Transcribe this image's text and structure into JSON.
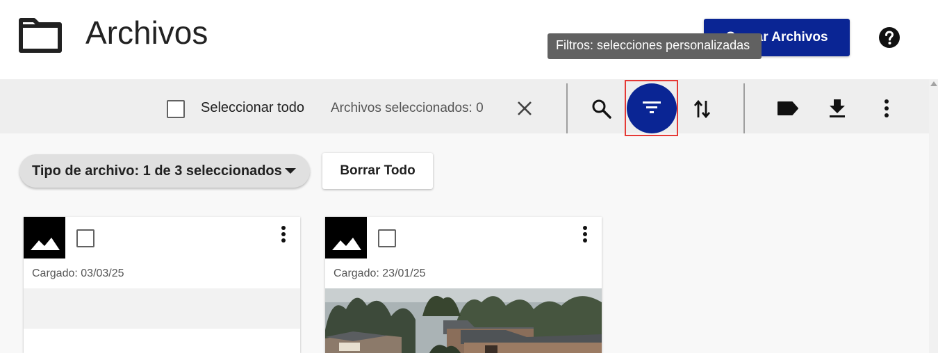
{
  "header": {
    "title": "Archivos",
    "upload_label": "Cargar Archivos",
    "upload_visible_label": "gar Archivos",
    "tooltip": "Filtros: selecciones personalizadas"
  },
  "toolbar": {
    "select_all_label": "Seleccionar todo",
    "selected_count": "Archivos seleccionados: 0",
    "icons": [
      "close-icon",
      "search-icon",
      "filter-icon",
      "sort-icon",
      "label-icon",
      "download-icon",
      "more-vert-icon"
    ]
  },
  "filters": {
    "type_chip_label": "Tipo de archivo: 1 de 3 seleccionados",
    "clear_all_label": "Borrar Todo"
  },
  "cards": [
    {
      "date_label": "Cargado: 03/03/25",
      "preview": "empty"
    },
    {
      "date_label": "Cargado: 23/01/25",
      "preview": "photo"
    }
  ],
  "colors": {
    "primary": "#0a2594",
    "highlight": "#e53935",
    "tooltip_bg": "#616161"
  }
}
